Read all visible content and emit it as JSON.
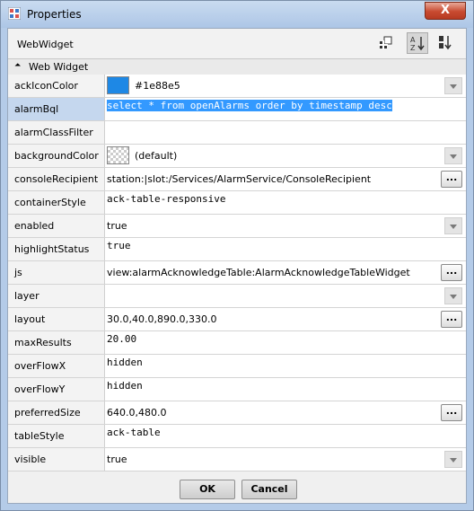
{
  "window": {
    "title": "Properties",
    "close_label": "X"
  },
  "header": {
    "title": "WebWidget"
  },
  "section": {
    "label": "Web Widget"
  },
  "properties": [
    {
      "name": "ackIconColor",
      "value": "#1e88e5",
      "swatch": "#1e88e5",
      "control": "dropdown"
    },
    {
      "name": "alarmBql",
      "value": "select * from openAlarms order by timestamp desc",
      "selected": true,
      "mono": true
    },
    {
      "name": "alarmClassFilter",
      "value": ""
    },
    {
      "name": "backgroundColor",
      "value": "(default)",
      "swatch": "checker",
      "control": "dropdown"
    },
    {
      "name": "consoleRecipient",
      "value": "station:|slot:/Services/AlarmService/ConsoleRecipient",
      "control": "ellipsis"
    },
    {
      "name": "containerStyle",
      "value": "ack-table-responsive",
      "mono": true
    },
    {
      "name": "enabled",
      "value": "true",
      "control": "dropdown"
    },
    {
      "name": "highlightStatus",
      "value": "true",
      "mono": true
    },
    {
      "name": "js",
      "value": "view:alarmAcknowledgeTable:AlarmAcknowledgeTableWidget",
      "control": "ellipsis"
    },
    {
      "name": "layer",
      "value": "",
      "control": "dropdown"
    },
    {
      "name": "layout",
      "value": "30.0,40.0,890.0,330.0",
      "control": "ellipsis"
    },
    {
      "name": "maxResults",
      "value": "20.00",
      "mono": true
    },
    {
      "name": "overFlowX",
      "value": "hidden",
      "mono": true
    },
    {
      "name": "overFlowY",
      "value": "hidden",
      "mono": true
    },
    {
      "name": "preferredSize",
      "value": "640.0,480.0",
      "control": "ellipsis"
    },
    {
      "name": "tableStyle",
      "value": "ack-table",
      "mono": true
    },
    {
      "name": "visible",
      "value": "true",
      "control": "dropdown"
    }
  ],
  "buttons": {
    "ok": "OK",
    "cancel": "Cancel",
    "ellipsis": "..."
  },
  "colors": {
    "accent_swatch": "#1e88e5",
    "selection": "#3399ff",
    "selected_row": "#c5d7ee"
  }
}
